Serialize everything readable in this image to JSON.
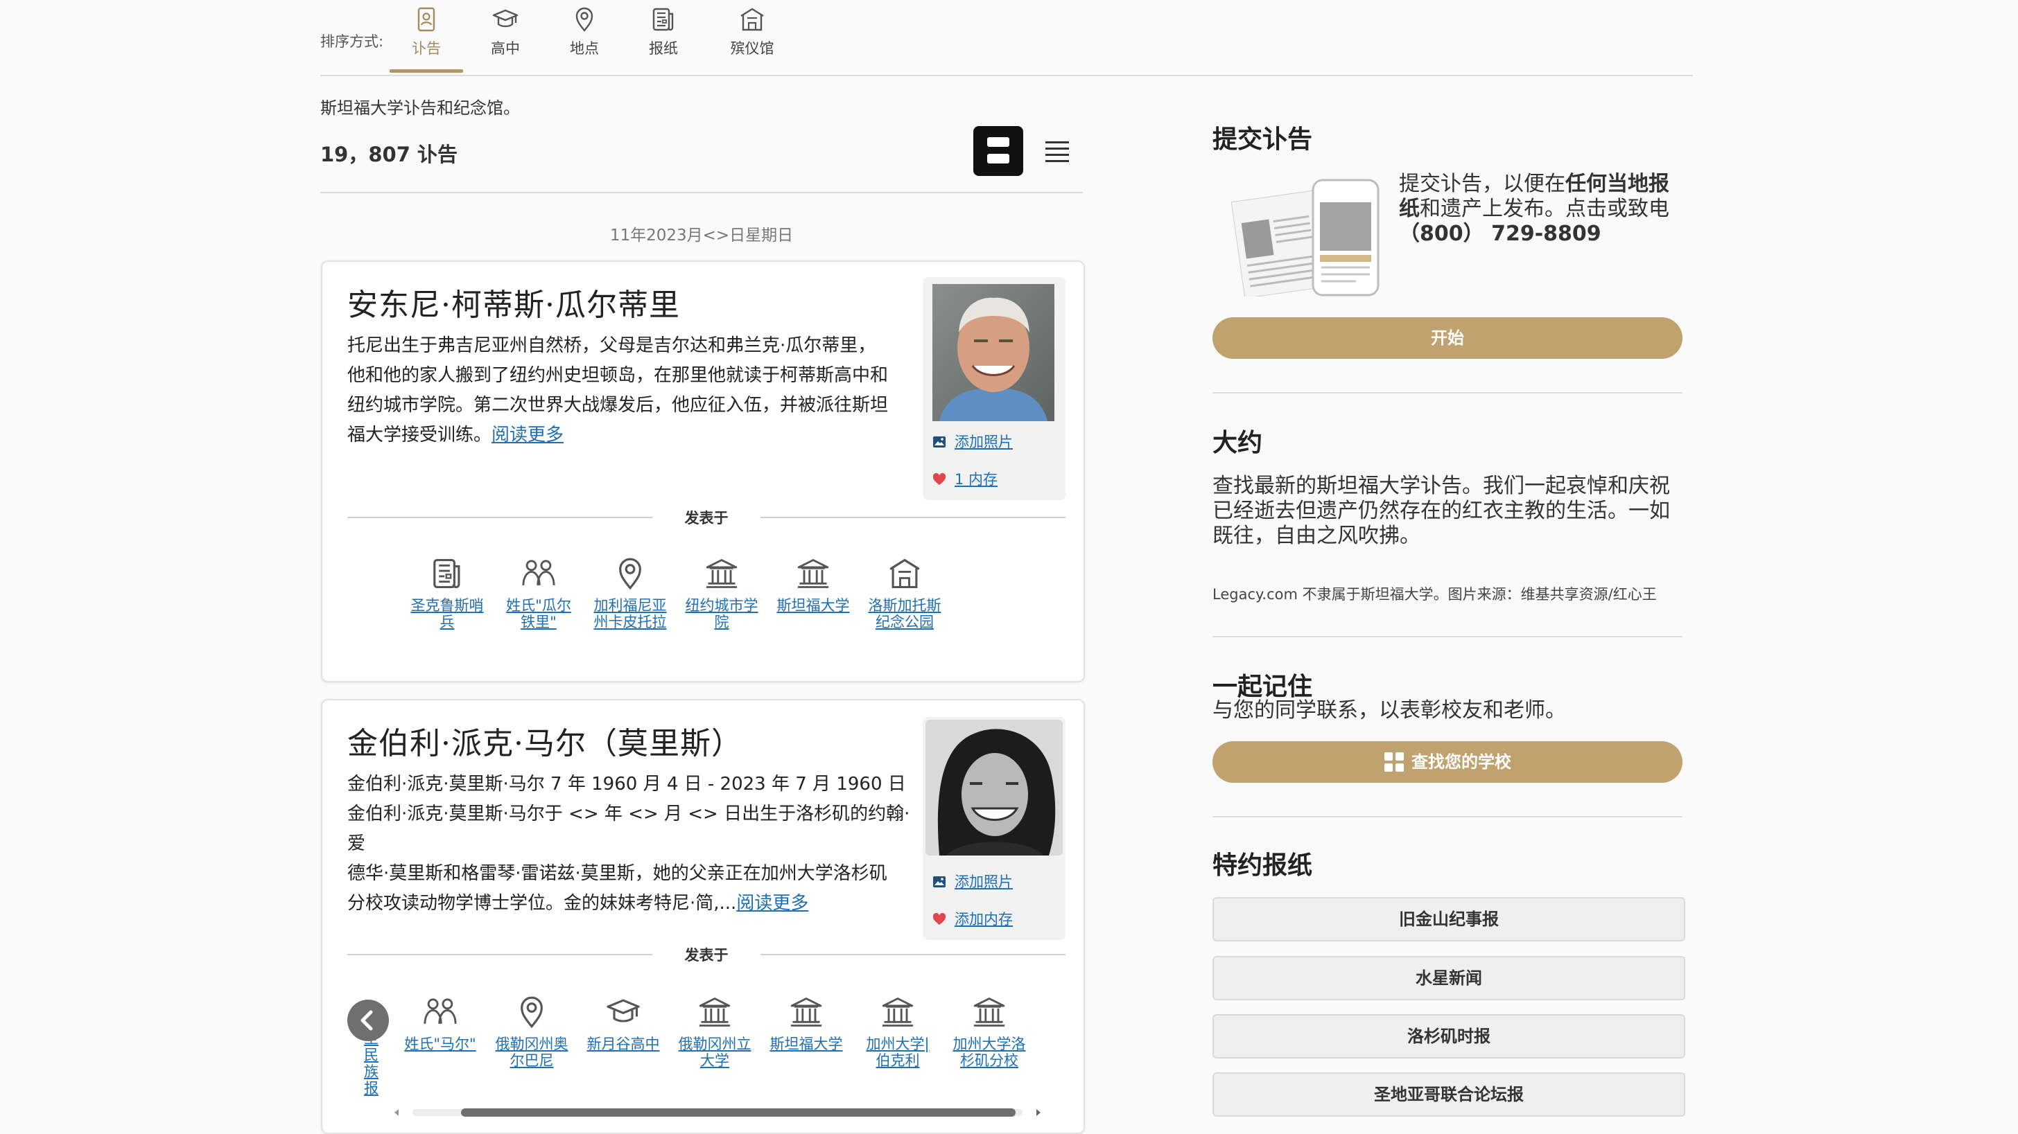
{
  "sort": {
    "label": "排序方式:",
    "tabs": [
      {
        "label": "讣告",
        "icon": "obituary-icon",
        "active": true
      },
      {
        "label": "高中",
        "icon": "graduation-cap-icon",
        "active": false
      },
      {
        "label": "地点",
        "icon": "location-pin-icon",
        "active": false
      },
      {
        "label": "报纸",
        "icon": "newspaper-icon",
        "active": false
      },
      {
        "label": "殡仪馆",
        "icon": "funeral-home-icon",
        "active": false
      }
    ]
  },
  "intro": "斯坦福大学讣告和纪念馆。",
  "count": "19，807 讣告",
  "date_header": "11年2023月<>日星期日",
  "obituaries": [
    {
      "name": "安东尼·柯蒂斯·瓜尔蒂里",
      "lines": [
        "托尼出生于弗吉尼亚州自然桥，父母是吉尔达和弗兰克·瓜尔蒂里，",
        "他和他的家人搬到了纽约州史坦顿岛，在那里他就读于柯蒂斯高中和",
        "纽约城市学院。第二次世界大战爆发后，他应征入伍，并被派往斯坦",
        "福大学接受训练。"
      ],
      "read_more": "阅读更多",
      "add_photo": "添加照片",
      "memories": "1 内存",
      "posted_in": "发表于",
      "associations": [
        {
          "l1": "圣克鲁斯哨",
          "l2": "兵",
          "icon": "newspaper-icon"
        },
        {
          "l1": "姓氏\"瓜尔",
          "l2": "铁里\"",
          "icon": "people-icon"
        },
        {
          "l1": "加利福尼亚",
          "l2": "州卡皮托拉",
          "icon": "location-pin-icon"
        },
        {
          "l1": "纽约城市学",
          "l2": "院",
          "icon": "college-icon"
        },
        {
          "l1": "斯坦福大学",
          "l2": "",
          "icon": "college-icon"
        },
        {
          "l1": "洛斯加托斯",
          "l2": "纪念公园",
          "icon": "funeral-home-icon"
        }
      ]
    },
    {
      "name": "金伯利·派克·马尔（莫里斯）",
      "lines": [
        "金伯利·派克·莫里斯·马尔 7 年 1960 月 4 日 - 2023 年 7 月 1960 日",
        "金伯利·派克·莫里斯·马尔于 <> 年 <> 月 <> 日出生于洛杉矶的约翰·爱",
        "德华·莫里斯和格雷琴·雷诺兹·莫里斯，她的父亲正在加州大学洛杉矶",
        "分校攻读动物学博士学位。金的妹妹考特尼·简,..."
      ],
      "read_more": "阅读更多",
      "add_photo": "添加照片",
      "memories": "添加内存",
      "posted_in": "发表于",
      "partial_assoc": {
        "l1": "圣民",
        "l2": "族报"
      },
      "associations": [
        {
          "l1": "姓氏\"马尔\"",
          "l2": "",
          "icon": "people-icon"
        },
        {
          "l1": "俄勒冈州奥",
          "l2": "尔巴尼",
          "icon": "location-pin-icon"
        },
        {
          "l1": "新月谷高中",
          "l2": "",
          "icon": "graduation-cap-icon"
        },
        {
          "l1": "俄勒冈州立",
          "l2": "大学",
          "icon": "college-icon"
        },
        {
          "l1": "斯坦福大学",
          "l2": "",
          "icon": "college-icon"
        },
        {
          "l1": "加州大学|",
          "l2": "伯克利",
          "icon": "college-icon"
        },
        {
          "l1": "加州大学洛",
          "l2": "杉矶分校",
          "icon": "college-icon"
        }
      ]
    }
  ],
  "submit": {
    "title": "提交讣告",
    "text_a": "提交讣告，以便在",
    "text_b": "任何当地报",
    "text_c": "纸",
    "text_d": "和遗产上发布。点击或致电",
    "phone": "（800） 729-8809",
    "button": "开始"
  },
  "about": {
    "title": "大约",
    "lines": [
      "查找最新的斯坦福大学讣告。我们一起哀悼和庆祝",
      "已经逝去但遗产仍然存在的红衣主教的生活。一如",
      "既往，自由之风吹拂。"
    ],
    "note": "Legacy.com 不隶属于斯坦福大学。图片来源：维基共享资源/红心王"
  },
  "remember": {
    "title": "一起记住",
    "text": "与您的同学联系，以表彰校友和老师。",
    "button": "查找您的学校"
  },
  "papers": {
    "title": "特约报纸",
    "items": [
      "旧金山纪事报",
      "水星新闻",
      "洛杉矶时报",
      "圣地亚哥联合论坛报"
    ]
  },
  "colors": {
    "accent": "#b39763",
    "button": "#bfa26d",
    "link": "#1f6fb5",
    "heart": "#e0474c"
  }
}
